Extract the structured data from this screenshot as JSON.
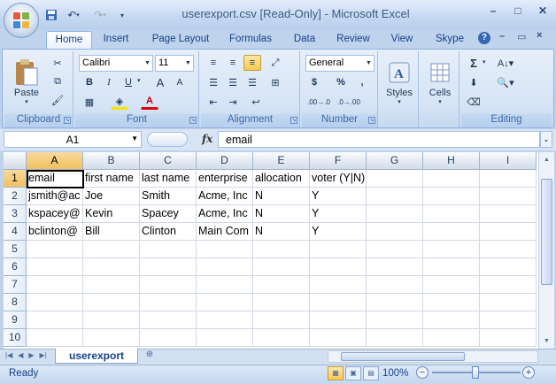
{
  "window": {
    "title": "userexport.csv  [Read-Only] - Microsoft Excel"
  },
  "qat": {
    "icons": [
      "save-icon",
      "undo-icon",
      "redo-icon",
      "customize-qat-icon"
    ]
  },
  "tabs": [
    "Home",
    "Insert",
    "Page Layout",
    "Formulas",
    "Data",
    "Review",
    "View",
    "Skype"
  ],
  "ribbon": {
    "clipboard": {
      "label": "Clipboard",
      "paste": "Paste"
    },
    "font": {
      "label": "Font",
      "font_name": "Calibri",
      "font_size": "11",
      "bold": "B",
      "italic": "I",
      "underline": "U",
      "grow": "A",
      "shrink": "A"
    },
    "alignment": {
      "label": "Alignment"
    },
    "number": {
      "label": "Number",
      "format": "General",
      "currency": "$",
      "percent": "%",
      "comma": ",",
      "inc_dec": ".00→.0",
      "dec_dec": ".0→.00"
    },
    "styles": {
      "label": "Styles"
    },
    "cells": {
      "label": "Cells"
    },
    "editing": {
      "label": "Editing",
      "sum": "Σ"
    }
  },
  "formula_bar": {
    "name_box": "A1",
    "fx": "fx",
    "content": "email"
  },
  "sheet": {
    "columns": [
      "A",
      "B",
      "C",
      "D",
      "E",
      "F",
      "G",
      "H",
      "I"
    ],
    "rows": [
      "1",
      "2",
      "3",
      "4",
      "5",
      "6",
      "7",
      "8",
      "9",
      "10"
    ],
    "cells": [
      [
        "email",
        "first name",
        "last name",
        "enterprise",
        "allocation",
        "voter (Y|N)"
      ],
      [
        "jsmith@ac",
        "Joe",
        "Smith",
        "Acme, Inc",
        "N",
        "Y"
      ],
      [
        "kspacey@",
        "Kevin",
        "Spacey",
        "Acme, Inc",
        "N",
        "Y"
      ],
      [
        "bclinton@",
        "Bill",
        "Clinton",
        "Main Com",
        "N",
        "Y"
      ]
    ],
    "selected_cell": "A1"
  },
  "sheet_tabs": [
    "userexport"
  ],
  "status": {
    "text": "Ready",
    "zoom": "100%"
  },
  "colors": {
    "accent": "#15428b",
    "ribbon": "#d6e4f5",
    "selection": "#f1c15f"
  }
}
